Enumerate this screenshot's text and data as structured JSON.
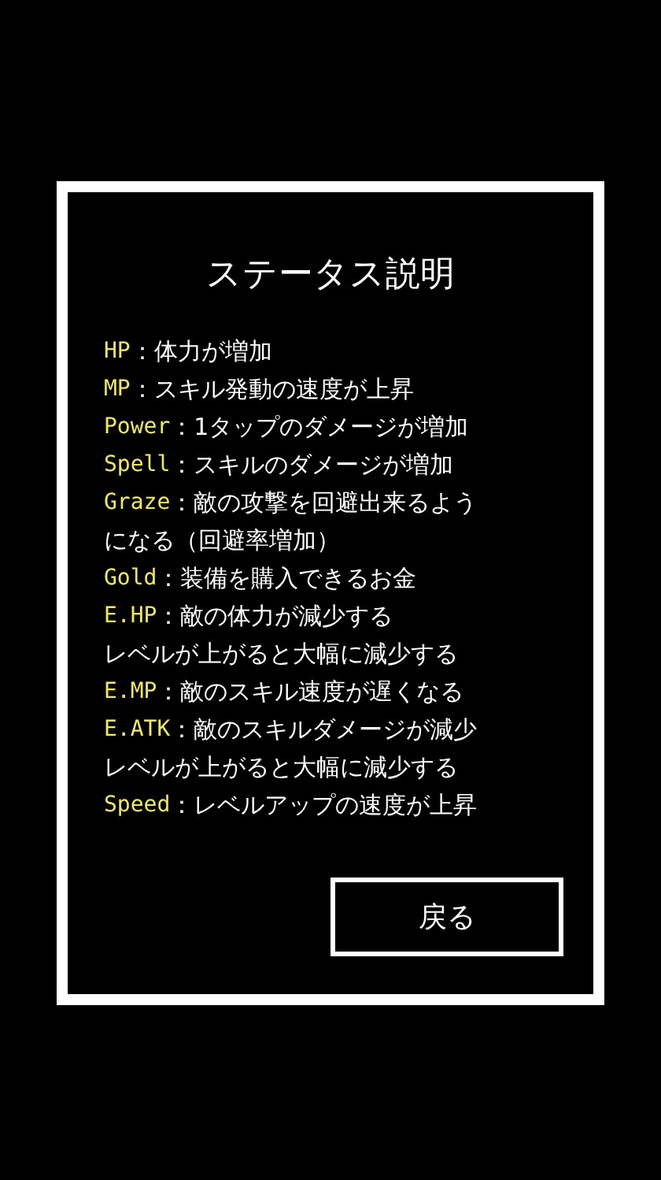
{
  "dialog": {
    "title": "ステータス説明",
    "entries": [
      {
        "label": "HP",
        "description": "：体力が増加"
      },
      {
        "label": "MP",
        "description": "：スキル発動の速度が上昇"
      },
      {
        "label": "Power",
        "description": "：1タップのダメージが増加"
      },
      {
        "label": "Spell",
        "description": "：スキルのダメージが増加"
      },
      {
        "label": "Graze",
        "description": "：敵の攻撃を回避出来るよう",
        "continuation": "になる（回避率増加）"
      },
      {
        "label": "Gold",
        "description": "：装備を購入できるお金"
      },
      {
        "label": "E.HP",
        "description": "：敵の体力が減少する",
        "continuation": "レベルが上がると大幅に減少する"
      },
      {
        "label": "E.MP",
        "description": "：敵のスキル速度が遅くなる"
      },
      {
        "label": "E.ATK",
        "description": "：敵のスキルダメージが減少",
        "continuation": "レベルが上がると大幅に減少する"
      },
      {
        "label": "Speed",
        "description": "：レベルアップの速度が上昇"
      }
    ],
    "back_button": "戻る"
  }
}
